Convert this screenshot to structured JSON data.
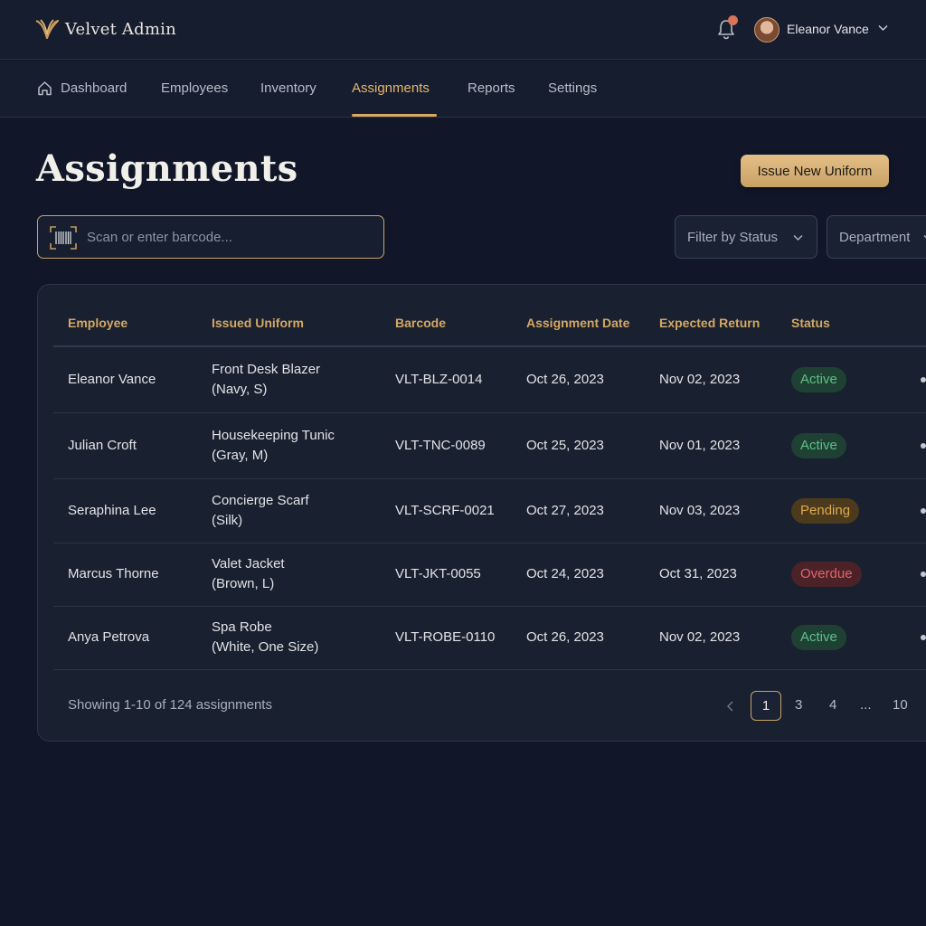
{
  "brand": {
    "name": "Velvet Admin"
  },
  "user": {
    "name": "Eleanor Vance"
  },
  "nav": {
    "items": [
      {
        "label": "Dashboard"
      },
      {
        "label": "Employees"
      },
      {
        "label": "Inventory"
      },
      {
        "label": "Assignments",
        "active": true
      },
      {
        "label": "Reports"
      },
      {
        "label": "Settings"
      }
    ]
  },
  "page": {
    "title": "Assignments",
    "issue_button": "Issue New Uniform",
    "barcode_placeholder": "Scan or enter barcode...",
    "filters": {
      "status": "Filter by Status",
      "department": "Department"
    }
  },
  "table": {
    "columns": [
      "Employee",
      "Issued Uniform",
      "Barcode",
      "Assignment Date",
      "Expected Return",
      "Status"
    ],
    "rows": [
      {
        "employee": "Eleanor Vance",
        "uniform_line1": "Front Desk Blazer",
        "uniform_line2": "(Navy, S)",
        "barcode": "VLT-BLZ-0014",
        "assigned": "Oct 26, 2023",
        "expected": "Nov 02, 2023",
        "status": "Active"
      },
      {
        "employee": "Julian Croft",
        "uniform_line1": "Housekeeping Tunic",
        "uniform_line2": "(Gray, M)",
        "barcode": "VLT-TNC-0089",
        "assigned": "Oct 25, 2023",
        "expected": "Nov 01, 2023",
        "status": "Active"
      },
      {
        "employee": "Seraphina Lee",
        "uniform_line1": "Concierge Scarf",
        "uniform_line2": "(Silk)",
        "barcode": "VLT-SCRF-0021",
        "assigned": "Oct 27, 2023",
        "expected": "Nov 03, 2023",
        "status": "Pending"
      },
      {
        "employee": "Marcus Thorne",
        "uniform_line1": "Valet Jacket",
        "uniform_line2": "(Brown, L)",
        "barcode": "VLT-JKT-0055",
        "assigned": "Oct 24, 2023",
        "expected": "Oct 31, 2023",
        "status": "Overdue"
      },
      {
        "employee": "Anya Petrova",
        "uniform_line1": "Spa Robe",
        "uniform_line2": "(White, One Size)",
        "barcode": "VLT-ROBE-0110",
        "assigned": "Oct 26, 2023",
        "expected": "Nov 02, 2023",
        "status": "Active"
      }
    ]
  },
  "pagination": {
    "info": "Showing 1-10 of 124 assignments",
    "current": "1",
    "pages": [
      "3",
      "4",
      "...",
      "10"
    ]
  },
  "colors": {
    "accent_gold": "#d4a864",
    "status_active": "#5fc08a",
    "status_pending": "#e0a94c",
    "status_overdue": "#e5646b",
    "notification_dot": "#d9735a"
  }
}
